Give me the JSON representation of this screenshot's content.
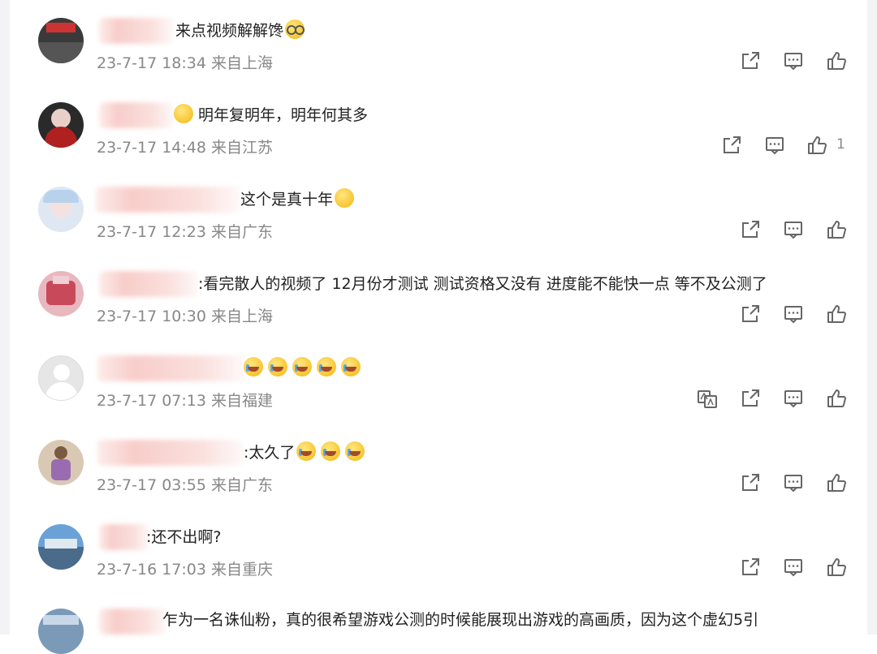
{
  "comments": [
    {
      "text": "来点视频解解馋",
      "time": "23-7-17 18:34 来自上海",
      "likes": ""
    },
    {
      "text": "明年复明年，明年何其多",
      "time": "23-7-17 14:48 来自江苏",
      "likes": "1"
    },
    {
      "text": "这个是真十年",
      "time": "23-7-17 12:23 来自广东",
      "likes": ""
    },
    {
      "text": ":看完散人的视频了 12月份才测试 测试资格又没有 进度能不能快一点 等不及公测了",
      "time": "23-7-17 10:30 来自上海",
      "likes": ""
    },
    {
      "text": "",
      "time": "23-7-17 07:13 来自福建",
      "likes": ""
    },
    {
      "text": ":太久了",
      "time": "23-7-17 03:55 来自广东",
      "likes": ""
    },
    {
      "text": ":还不出啊?",
      "time": "23-7-16 17:03 来自重庆",
      "likes": ""
    },
    {
      "text": "乍为一名诛仙粉，真的很希望游戏公测的时候能展现出游戏的高画质，因为这个虚幻5引",
      "time": "",
      "likes": ""
    }
  ],
  "icons": {
    "share": "share-icon",
    "comment": "comment-icon",
    "like": "thumbs-up-icon",
    "translate": "translate-icon"
  }
}
